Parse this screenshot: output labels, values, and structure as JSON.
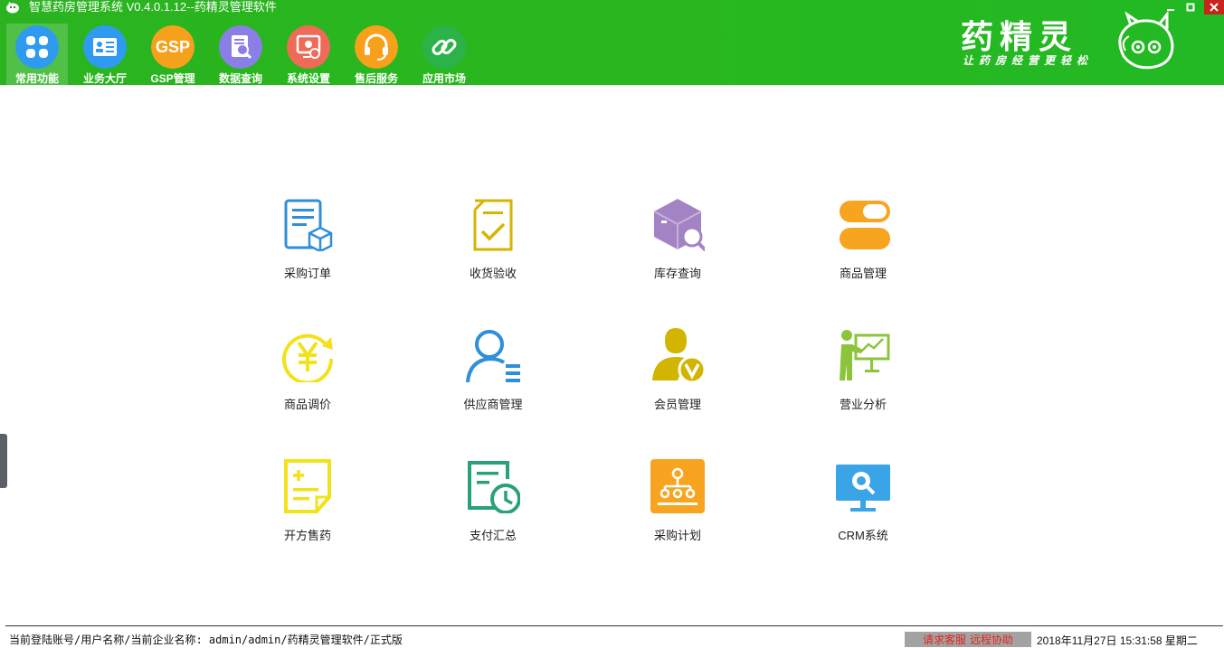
{
  "window": {
    "title": "智慧药房管理系统 V0.4.0.1.12--药精灵管理软件"
  },
  "nav": {
    "items": [
      {
        "label": "常用功能",
        "icon": "apps-grid-icon",
        "color": "#2f9bf0"
      },
      {
        "label": "业务大厅",
        "icon": "id-card-icon",
        "color": "#2f9bf0"
      },
      {
        "label": "GSP管理",
        "icon": "gsp-icon",
        "color": "#f6a11c"
      },
      {
        "label": "数据查询",
        "icon": "document-search-icon",
        "color": "#8a7fe6"
      },
      {
        "label": "系统设置",
        "icon": "settings-doc-icon",
        "color": "#f06a58"
      },
      {
        "label": "售后服务",
        "icon": "headset-icon",
        "color": "#f7a01c"
      },
      {
        "label": "应用市场",
        "icon": "link-icon",
        "color": "#2bb34a"
      }
    ]
  },
  "brand": {
    "title": "药精灵",
    "slogan": "让药房经营更轻松"
  },
  "functions": [
    {
      "label": "采购订单",
      "icon": "purchase-order-icon",
      "color": "#2f8fd8"
    },
    {
      "label": "收货验收",
      "icon": "receipt-check-icon",
      "color": "#d6b400"
    },
    {
      "label": "库存查询",
      "icon": "inventory-search-icon",
      "color": "#a483c4"
    },
    {
      "label": "商品管理",
      "icon": "capsule-icon",
      "color": "#f7a520"
    },
    {
      "label": "商品调价",
      "icon": "price-adjust-icon",
      "color": "#f2e21c"
    },
    {
      "label": "供应商管理",
      "icon": "supplier-icon",
      "color": "#2f8fd8"
    },
    {
      "label": "会员管理",
      "icon": "member-icon",
      "color": "#d1b500"
    },
    {
      "label": "营业分析",
      "icon": "business-analysis-icon",
      "color": "#8cc43c"
    },
    {
      "label": "开方售药",
      "icon": "prescription-icon",
      "color": "#f2e21c"
    },
    {
      "label": "支付汇总",
      "icon": "payment-summary-icon",
      "color": "#2aa17a"
    },
    {
      "label": "采购计划",
      "icon": "purchase-plan-icon",
      "color": "#f7a520"
    },
    {
      "label": "CRM系统",
      "icon": "crm-icon",
      "color": "#3aa5e6"
    }
  ],
  "status": {
    "account": "当前登陆账号/用户名称/当前企业名称: admin/admin/药精灵管理软件/正式版",
    "support": "请求客服",
    "remote": "远程协助",
    "datetime": "2018年11月27日  15:31:58  星期二"
  }
}
